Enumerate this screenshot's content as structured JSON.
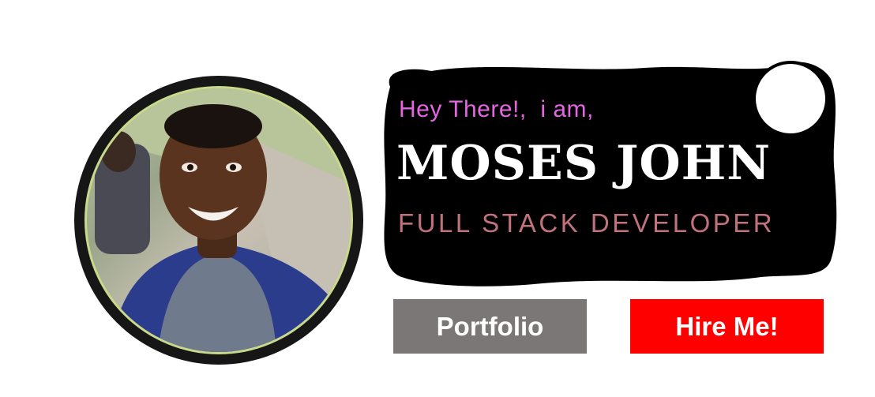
{
  "profile": {
    "greeting": "Hey There!,  i am,",
    "name": "MOSES JOHN",
    "role": "FULL STACK DEVELOPER"
  },
  "actions": {
    "portfolio_label": "Portfolio",
    "hire_label": "Hire Me!"
  },
  "colors": {
    "greeting": "#e466e0",
    "role": "#c2727c",
    "portfolio_button": "#7a7776",
    "hire_button": "#fe0000",
    "card_background": "#000000"
  }
}
